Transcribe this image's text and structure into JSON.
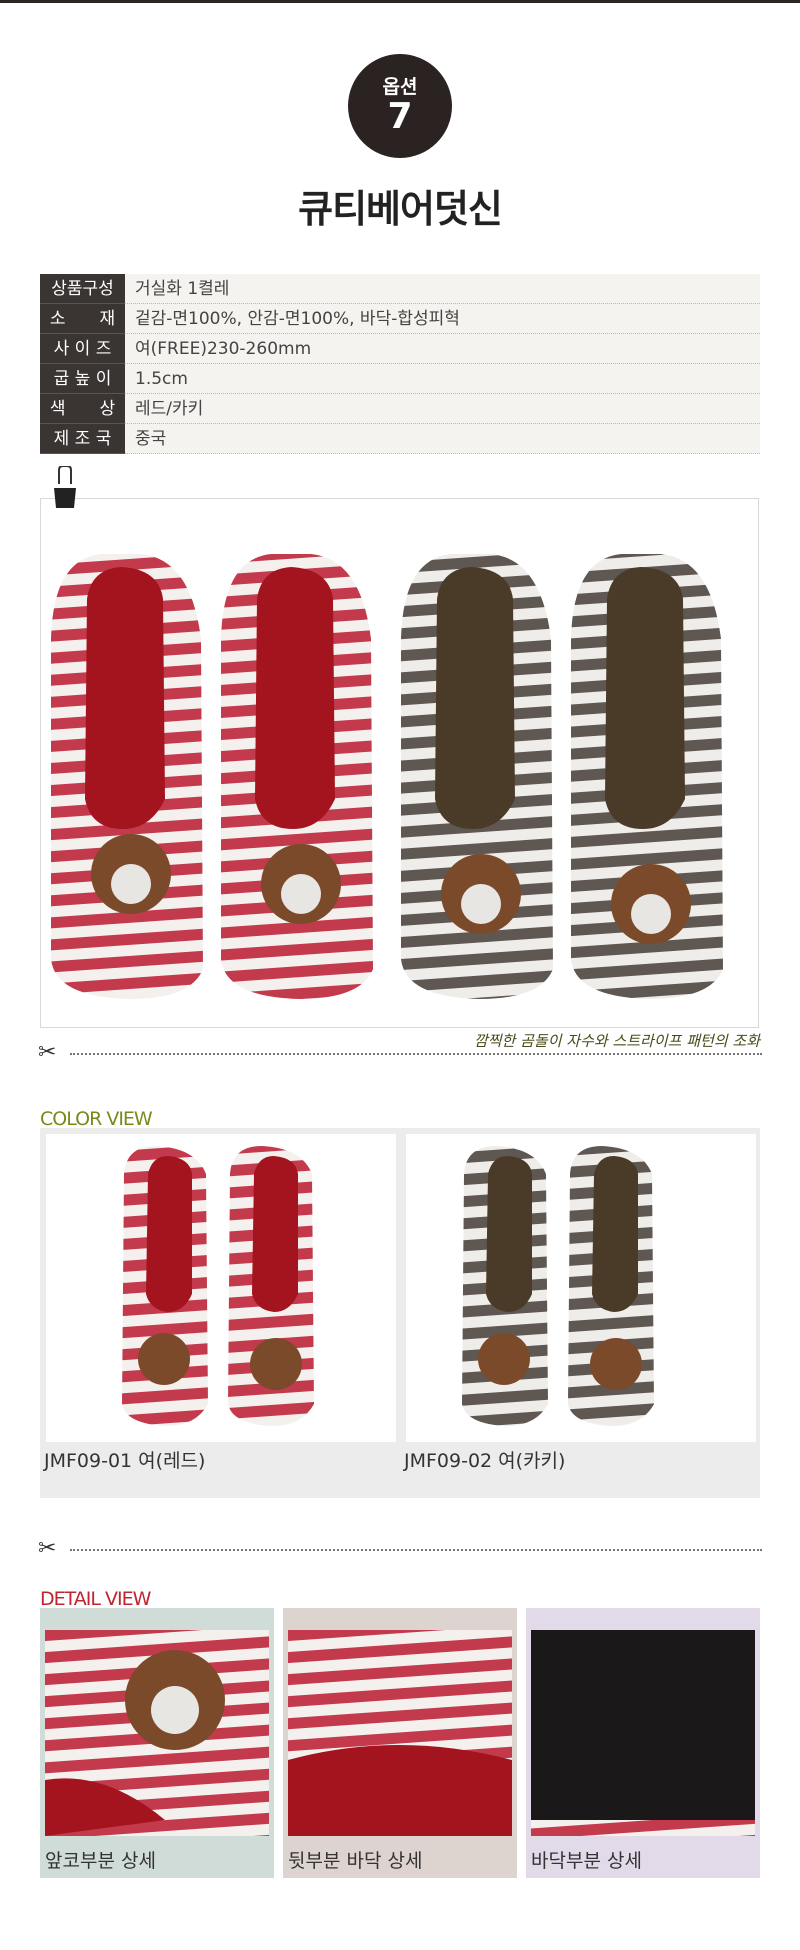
{
  "header": {
    "option_label": "옵션",
    "option_number": "7",
    "title": "큐티베어덧신"
  },
  "specs": [
    {
      "key": "상품구성",
      "value": "거실화 1켤레"
    },
    {
      "key": "소　　재",
      "value": "겉감-면100%, 안감-면100%, 바닥-합성피혁"
    },
    {
      "key": "사 이 즈",
      "value": "여(FREE)230-260mm"
    },
    {
      "key": "굽 높 이",
      "value": "1.5cm"
    },
    {
      "key": "색　　상",
      "value": "레드/카키"
    },
    {
      "key": "제 조 국",
      "value": "중국"
    }
  ],
  "main_photo": {
    "caption": "깜찍한 곰돌이 자수와 스트라이프 패턴의 조화"
  },
  "color_view": {
    "heading": "COLOR VIEW",
    "heading_color": "#7a8a1a",
    "items": [
      {
        "label": "JMF09-01 여(레드)",
        "stripe": "#c0364a",
        "inner": "#a3141f"
      },
      {
        "label": "JMF09-02 여(카키)",
        "stripe": "#5c5550",
        "inner": "#4a3b28"
      }
    ]
  },
  "detail_view": {
    "heading": "DETAIL VIEW",
    "heading_color": "#c0242e",
    "items": [
      {
        "label": "앞코부분 상세",
        "bg": "#d0dcd8"
      },
      {
        "label": "뒷부분 바닥 상세",
        "bg": "#ddd3cf"
      },
      {
        "label": "바닥부분 상세",
        "bg": "#e2dae9"
      }
    ]
  },
  "icons": [
    "binder-clip-icon",
    "scissors-icon"
  ]
}
